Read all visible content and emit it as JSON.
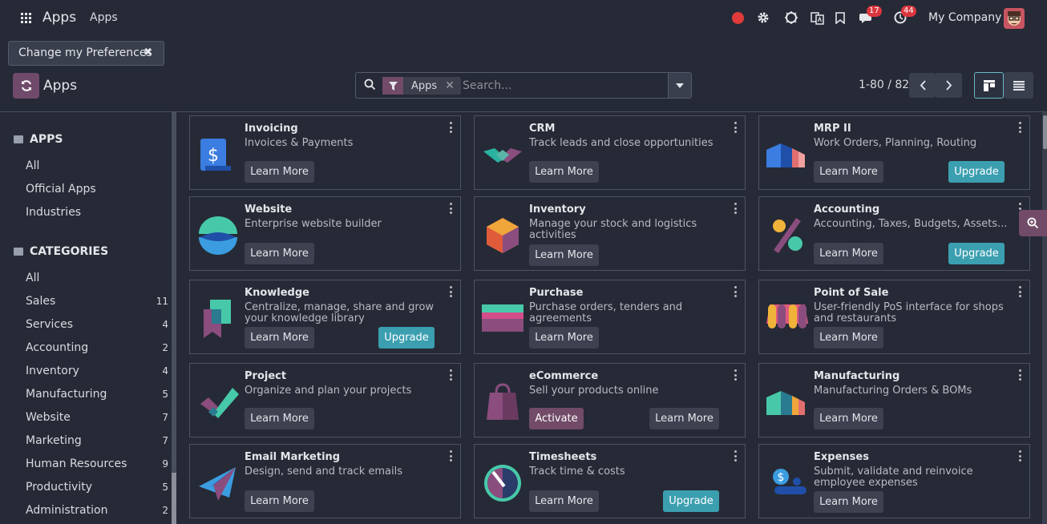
{
  "topbar": {
    "brand": "Apps",
    "menu_item": "Apps",
    "icons": [
      "record-icon",
      "settings-icon",
      "debug-icon",
      "language-icon",
      "bookmark-icon",
      "chat-icon",
      "activity-icon"
    ],
    "chat_count": "17",
    "activity_count": "44",
    "company": "My Company"
  },
  "preferences_button": {
    "label": "Change my Preferences"
  },
  "control_panel": {
    "title": "Apps",
    "search": {
      "facet": "Apps",
      "placeholder": "Search..."
    },
    "pager": "1-80 / 82"
  },
  "sidebar": {
    "apps_heading": "APPS",
    "apps_items": [
      "All",
      "Official Apps",
      "Industries"
    ],
    "categories_heading": "CATEGORIES",
    "categories": [
      {
        "label": "All",
        "count": ""
      },
      {
        "label": "Sales",
        "count": "11"
      },
      {
        "label": "Services",
        "count": "4"
      },
      {
        "label": "Accounting",
        "count": "2"
      },
      {
        "label": "Inventory",
        "count": "4"
      },
      {
        "label": "Manufacturing",
        "count": "5"
      },
      {
        "label": "Website",
        "count": "7"
      },
      {
        "label": "Marketing",
        "count": "7"
      },
      {
        "label": "Human Resources",
        "count": "9"
      },
      {
        "label": "Productivity",
        "count": "5"
      },
      {
        "label": "Administration",
        "count": "2"
      }
    ]
  },
  "labels": {
    "learn_more": "Learn More",
    "upgrade": "Upgrade",
    "activate": "Activate"
  },
  "apps": [
    {
      "name": "Invoicing",
      "desc": "Invoices & Payments"
    },
    {
      "name": "CRM",
      "desc": "Track leads and close opportunities"
    },
    {
      "name": "MRP II",
      "desc": "Work Orders, Planning, Routing"
    },
    {
      "name": "Website",
      "desc": "Enterprise website builder"
    },
    {
      "name": "Inventory",
      "desc": "Manage your stock and logistics activities"
    },
    {
      "name": "Accounting",
      "desc": "Accounting, Taxes, Budgets, Assets..."
    },
    {
      "name": "Knowledge",
      "desc": "Centralize, manage, share and grow your knowledge library"
    },
    {
      "name": "Purchase",
      "desc": "Purchase orders, tenders and agreements"
    },
    {
      "name": "Point of Sale",
      "desc": "User-friendly PoS interface for shops and restaurants"
    },
    {
      "name": "Project",
      "desc": "Organize and plan your projects"
    },
    {
      "name": "eCommerce",
      "desc": "Sell your products online"
    },
    {
      "name": "Manufacturing",
      "desc": "Manufacturing Orders & BOMs"
    },
    {
      "name": "Email Marketing",
      "desc": "Design, send and track emails"
    },
    {
      "name": "Timesheets",
      "desc": "Track time & costs"
    },
    {
      "name": "Expenses",
      "desc": "Submit, validate and reinvoice employee expenses"
    }
  ]
}
